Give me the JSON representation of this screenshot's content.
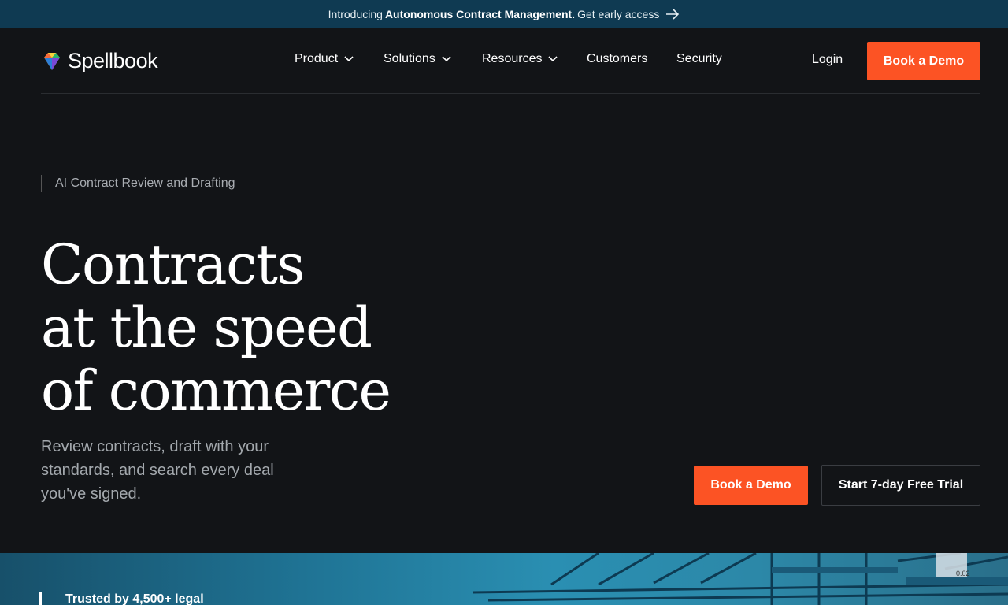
{
  "announcement": {
    "prefix": "Introducing",
    "highlight": "Autonomous Contract Management.",
    "cta": "Get early access",
    "arrow_icon": "arrow-right-icon"
  },
  "brand": {
    "name": "Spellbook",
    "logo_icon": "gem-icon"
  },
  "nav": {
    "items": [
      {
        "label": "Product",
        "has_dropdown": true
      },
      {
        "label": "Solutions",
        "has_dropdown": true
      },
      {
        "label": "Resources",
        "has_dropdown": true
      },
      {
        "label": "Customers",
        "has_dropdown": false
      },
      {
        "label": "Security",
        "has_dropdown": false
      }
    ],
    "login": "Login",
    "demo": "Book a Demo"
  },
  "hero": {
    "eyebrow": "AI Contract Review and Drafting",
    "headline": [
      "Contracts",
      "at the speed",
      "of commerce"
    ],
    "subtext": "Review contracts, draft with your standards, and search every deal you've signed.",
    "primary_cta": "Book a Demo",
    "secondary_cta": "Start 7-day Free Trial"
  },
  "band": {
    "trusted": "Trusted by 4,500+ legal",
    "image_label": "0.02"
  },
  "colors": {
    "accent": "#fc5324",
    "background": "#121417",
    "announcement_bg": "#0f3a52"
  }
}
